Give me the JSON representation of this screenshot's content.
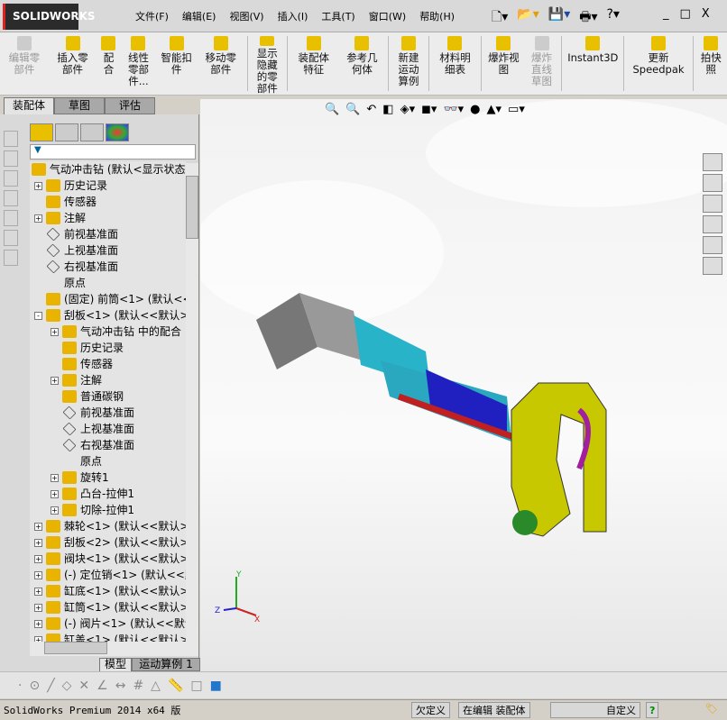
{
  "app": {
    "logo": "SOLIDWORKS",
    "menus": [
      "文件(F)",
      "编辑(E)",
      "视图(V)",
      "插入(I)",
      "工具(T)",
      "窗口(W)",
      "帮助(H)"
    ],
    "quick_access": [
      "new-icon",
      "open-icon",
      "save-icon",
      "print-icon",
      "help-icon"
    ],
    "window_buttons": [
      "_",
      "□",
      "X"
    ]
  },
  "toolbar": [
    {
      "label": "编辑零部件",
      "disabled": true
    },
    {
      "label": "插入零部件",
      "disabled": false
    },
    {
      "label": "配合",
      "disabled": false
    },
    {
      "label": "线性零部件...",
      "disabled": false
    },
    {
      "label": "智能扣件",
      "disabled": false
    },
    {
      "label": "移动零部件",
      "disabled": false
    },
    {
      "label": "显示隐藏的零部件",
      "disabled": false
    },
    {
      "label": "装配体特征",
      "disabled": false
    },
    {
      "label": "参考几何体",
      "disabled": false
    },
    {
      "label": "新建运动算例",
      "disabled": false
    },
    {
      "label": "材料明细表",
      "disabled": false
    },
    {
      "label": "爆炸视图",
      "disabled": false
    },
    {
      "label": "爆炸直线草图",
      "disabled": true
    },
    {
      "label": "Instant3D",
      "disabled": false
    },
    {
      "label": "更新Speedpak",
      "disabled": false
    },
    {
      "label": "拍快照",
      "disabled": false
    }
  ],
  "tabs": [
    "装配体",
    "草图",
    "评估"
  ],
  "tree": [
    {
      "label": "气动冲击钻  (默认<显示状态",
      "level": 0,
      "exp": ""
    },
    {
      "label": "历史记录",
      "level": 1,
      "exp": "+"
    },
    {
      "label": "传感器",
      "level": 1,
      "exp": ""
    },
    {
      "label": "注解",
      "level": 1,
      "exp": "+"
    },
    {
      "label": "前视基准面",
      "level": 1,
      "exp": ""
    },
    {
      "label": "上视基准面",
      "level": 1,
      "exp": ""
    },
    {
      "label": "右视基准面",
      "level": 1,
      "exp": ""
    },
    {
      "label": "原点",
      "level": 1,
      "exp": ""
    },
    {
      "label": "(固定) 前筒<1> (默认<<",
      "level": 1,
      "exp": ""
    },
    {
      "label": "刮板<1> (默认<<默认>_显",
      "level": 1,
      "exp": "-"
    },
    {
      "label": "气动冲击钻 中的配合",
      "level": 2,
      "exp": "+"
    },
    {
      "label": "历史记录",
      "level": 2,
      "exp": ""
    },
    {
      "label": "传感器",
      "level": 2,
      "exp": ""
    },
    {
      "label": "注解",
      "level": 2,
      "exp": "+"
    },
    {
      "label": "普通碳钢",
      "level": 2,
      "exp": ""
    },
    {
      "label": "前视基准面",
      "level": 2,
      "exp": ""
    },
    {
      "label": "上视基准面",
      "level": 2,
      "exp": ""
    },
    {
      "label": "右视基准面",
      "level": 2,
      "exp": ""
    },
    {
      "label": "原点",
      "level": 2,
      "exp": ""
    },
    {
      "label": "旋转1",
      "level": 2,
      "exp": "+"
    },
    {
      "label": "凸台-拉伸1",
      "level": 2,
      "exp": "+"
    },
    {
      "label": "切除-拉伸1",
      "level": 2,
      "exp": "+"
    },
    {
      "label": "棘轮<1> (默认<<默认>_显",
      "level": 1,
      "exp": "+"
    },
    {
      "label": "刮板<2> (默认<<默认>_显",
      "level": 1,
      "exp": "+"
    },
    {
      "label": "阀块<1> (默认<<默认>_显",
      "level": 1,
      "exp": "+"
    },
    {
      "label": "(-) 定位销<1> (默认<<默",
      "level": 1,
      "exp": "+"
    },
    {
      "label": "缸底<1> (默认<<默认>_显",
      "level": 1,
      "exp": "+"
    },
    {
      "label": "缸筒<1> (默认<<默认>_显",
      "level": 1,
      "exp": "+"
    },
    {
      "label": "(-) 阀片<1> (默认<<默认",
      "level": 1,
      "exp": "+"
    },
    {
      "label": "缸盖<1> (默认<<默认>_显",
      "level": 1,
      "exp": "+"
    }
  ],
  "bottom_tabs": [
    "模型",
    "运动算例 1"
  ],
  "status": {
    "product": "SolidWorks Premium 2014 x64 版",
    "state": "欠定义",
    "editing": "在编辑 装配体",
    "units": "自定义",
    "help": "?"
  },
  "triad": {
    "x": "X",
    "y": "Y",
    "z": "Z"
  },
  "colors": {
    "accent": "#d22",
    "tree_icon": "#e8b400",
    "part_yellow": "#c8c800",
    "part_cyan": "#29b3c8",
    "part_blue": "#2020c0",
    "part_red": "#c02020",
    "part_gray": "#777"
  }
}
